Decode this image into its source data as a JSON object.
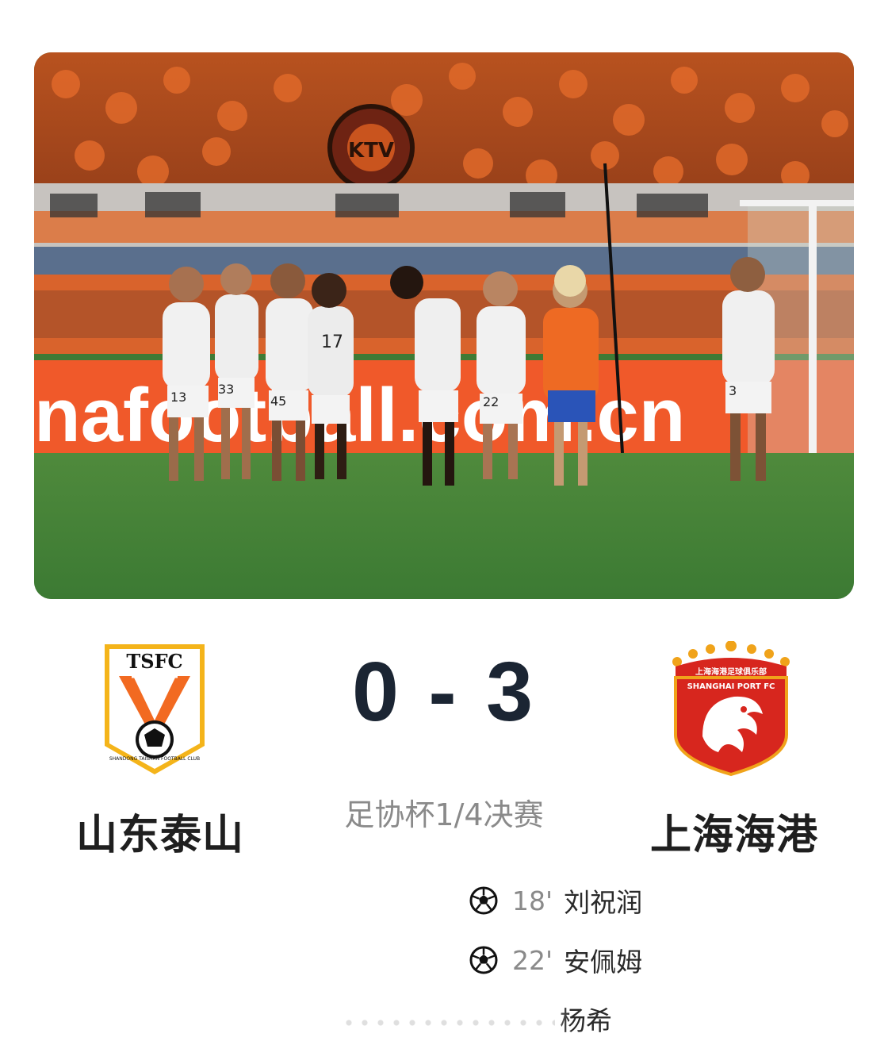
{
  "photo": {
    "ad_board_text": "nafootball.com.cn",
    "player_numbers": [
      "13",
      "33",
      "45",
      "17",
      "22",
      "3"
    ],
    "logo_text": "KTV"
  },
  "match": {
    "home_team": {
      "name": "山东泰山",
      "logo_text": "TSFC",
      "logo_subtext": "SHANDONG TAISHAN FOOTBALL CLUB"
    },
    "away_team": {
      "name": "上海海港",
      "logo_text_cn": "上海海港足球俱乐部",
      "logo_text_en": "SHANGHAI PORT FC"
    },
    "score": "0 - 3",
    "competition": "足协杯1/4决赛",
    "goals": [
      {
        "minute": "18'",
        "scorer": "刘祝润"
      },
      {
        "minute": "22'",
        "scorer": "安佩姆"
      },
      {
        "minute": "",
        "scorer": "杨希"
      }
    ]
  },
  "colors": {
    "score": "#1b2533",
    "muted": "#8a8a8a",
    "home_orange": "#f26a21",
    "away_red": "#d7261e"
  },
  "icons": [
    "soccer-ball-icon"
  ]
}
